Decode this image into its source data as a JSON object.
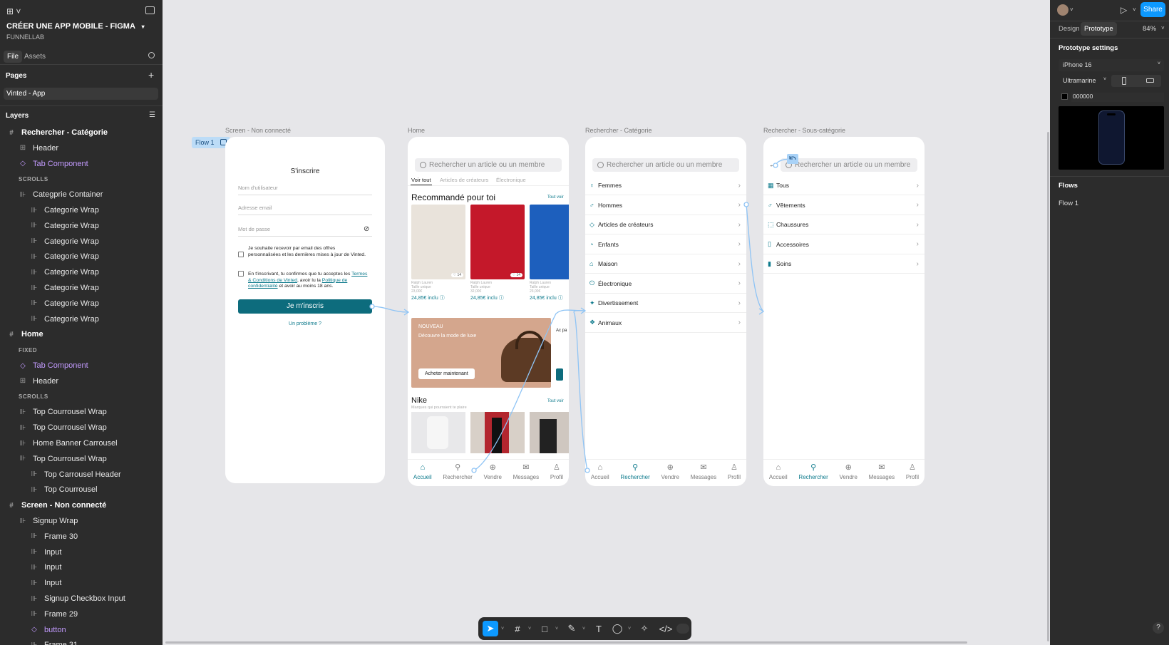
{
  "file": {
    "title": "CRÉER UNE APP MOBILE - FIGMA",
    "team": "FUNNELLAB"
  },
  "left_tabs": {
    "file": "File",
    "assets": "Assets"
  },
  "pages": {
    "label": "Pages",
    "items": [
      "Vinted - App"
    ]
  },
  "layers": {
    "label": "Layers",
    "items": [
      {
        "t": "frame",
        "d": 0,
        "label": "Rechercher - Catégorie"
      },
      {
        "t": "frame-s",
        "d": 1,
        "label": "Header"
      },
      {
        "t": "comp",
        "d": 1,
        "label": "Tab Component"
      },
      {
        "t": "sub",
        "d": 1,
        "label": "SCROLLS"
      },
      {
        "t": "auto",
        "d": 1,
        "label": "Categprie Container"
      },
      {
        "t": "auto",
        "d": 2,
        "label": "Categorie Wrap"
      },
      {
        "t": "auto",
        "d": 2,
        "label": "Categorie Wrap"
      },
      {
        "t": "auto",
        "d": 2,
        "label": "Categorie Wrap"
      },
      {
        "t": "auto",
        "d": 2,
        "label": "Categorie Wrap"
      },
      {
        "t": "auto",
        "d": 2,
        "label": "Categorie Wrap"
      },
      {
        "t": "auto",
        "d": 2,
        "label": "Categorie Wrap"
      },
      {
        "t": "auto",
        "d": 2,
        "label": "Categorie Wrap"
      },
      {
        "t": "auto",
        "d": 2,
        "label": "Categorie Wrap"
      },
      {
        "t": "frame",
        "d": 0,
        "label": "Home"
      },
      {
        "t": "sub",
        "d": 1,
        "label": "FIXED"
      },
      {
        "t": "comp",
        "d": 1,
        "label": "Tab Component"
      },
      {
        "t": "frame-s",
        "d": 1,
        "label": "Header"
      },
      {
        "t": "sub",
        "d": 1,
        "label": "SCROLLS"
      },
      {
        "t": "auto",
        "d": 1,
        "label": "Top Courrousel Wrap"
      },
      {
        "t": "auto",
        "d": 1,
        "label": "Top Courrousel Wrap"
      },
      {
        "t": "auto",
        "d": 1,
        "label": "Home Banner Carrousel"
      },
      {
        "t": "auto",
        "d": 1,
        "label": "Top Courrousel Wrap"
      },
      {
        "t": "auto",
        "d": 2,
        "label": "Top Carrousel Header"
      },
      {
        "t": "auto",
        "d": 2,
        "label": "Top Courrousel"
      },
      {
        "t": "frame",
        "d": 0,
        "label": "Screen - Non connecté"
      },
      {
        "t": "auto",
        "d": 1,
        "label": "Signup Wrap"
      },
      {
        "t": "auto",
        "d": 2,
        "label": "Frame 30"
      },
      {
        "t": "auto",
        "d": 2,
        "label": "Input"
      },
      {
        "t": "auto",
        "d": 2,
        "label": "Input"
      },
      {
        "t": "auto",
        "d": 2,
        "label": "Input"
      },
      {
        "t": "auto",
        "d": 2,
        "label": "Signup Checkbox Input"
      },
      {
        "t": "auto",
        "d": 2,
        "label": "Frame 29"
      },
      {
        "t": "comp",
        "d": 2,
        "label": "button"
      },
      {
        "t": "auto",
        "d": 2,
        "label": "Frame 31"
      }
    ]
  },
  "right_panel": {
    "tabs": {
      "design": "Design",
      "prototype": "Prototype"
    },
    "zoom": "84%",
    "share": "Share",
    "settings_title": "Prototype settings",
    "device": "iPhone 16",
    "model": "Ultramarine",
    "bg_color": "000000",
    "flows_title": "Flows",
    "flow_item": "Flow 1",
    "help": "?"
  },
  "canvas": {
    "flow_badge": "Flow 1",
    "frames": {
      "signup_label": "Screen - Non connecté",
      "home_label": "Home",
      "cat_label": "Rechercher - Catégorie",
      "subcat_label": "Rechercher - Sous-catégorie"
    },
    "signup": {
      "title": "S'inscrire",
      "username": "Nom d'utilisateur",
      "email": "Adresse email",
      "password": "Mot de passe",
      "check1": "Je souhaite recevoir par email des offres personnalisées et les dernières mises à jour de Vinted.",
      "check2_pre": "En t'inscrivant, tu confirmes que tu acceptes les ",
      "check2_link1": "Termes & Conditions de Vinted",
      "check2_mid": ", avoir lu la ",
      "check2_link2": "Politique de confidentialité",
      "check2_post": " et avoir au moins 18 ans.",
      "button": "Je m'inscris",
      "problem": "Un problème ?"
    },
    "search_placeholder": "Rechercher un article ou un membre",
    "home": {
      "tabs": [
        "Voir tout",
        "Articles de créateurs",
        "Électronique"
      ],
      "recommended": "Recommandé pour toi",
      "see_all": "Tout voir",
      "products": [
        {
          "brand": "Ralph Lauren",
          "size": "Taille unique",
          "old": "23,00€",
          "price": "24,85€ inclu",
          "likes": "14",
          "color": "#e9e3db"
        },
        {
          "brand": "Ralph Lauren",
          "size": "Taille unique",
          "old": "32,00€",
          "price": "24,85€ inclu",
          "likes": "14",
          "color": "#c4182a"
        },
        {
          "brand": "Ralph Lauren",
          "size": "Taille unique",
          "old": "23,00€",
          "price": "24,85€ inclu",
          "likes": "14",
          "color": "#1d5fbd"
        }
      ],
      "banner_tag": "NOUVEAU",
      "banner_text": "Découvre la mode de luxe",
      "banner_button": "Acheter maintenant",
      "peek_text": "Ac pa",
      "nike_title": "Nike",
      "nike_sub": "Marques qui pourraient te plaire",
      "nike_see_all": "Tout voir"
    },
    "categories": [
      {
        "label": "Femmes",
        "icon": "♀"
      },
      {
        "label": "Hommes",
        "icon": "♂"
      },
      {
        "label": "Articles de créateurs",
        "icon": "◇"
      },
      {
        "label": "Enfants",
        "icon": "◔"
      },
      {
        "label": "Maison",
        "icon": "⌂"
      },
      {
        "label": "Électronique",
        "icon": "⏻"
      },
      {
        "label": "Divertissement",
        "icon": "✦"
      },
      {
        "label": "Animaux",
        "icon": "❖"
      }
    ],
    "subcategories": [
      {
        "label": "Tous",
        "icon": "▦"
      },
      {
        "label": "Vêtements",
        "icon": "♂"
      },
      {
        "label": "Chaussures",
        "icon": "⬚"
      },
      {
        "label": "Accessoires",
        "icon": "▯"
      },
      {
        "label": "Soins",
        "icon": "▮"
      }
    ],
    "nav": [
      "Accueil",
      "Rechercher",
      "Vendre",
      "Messages",
      "Profil"
    ]
  }
}
